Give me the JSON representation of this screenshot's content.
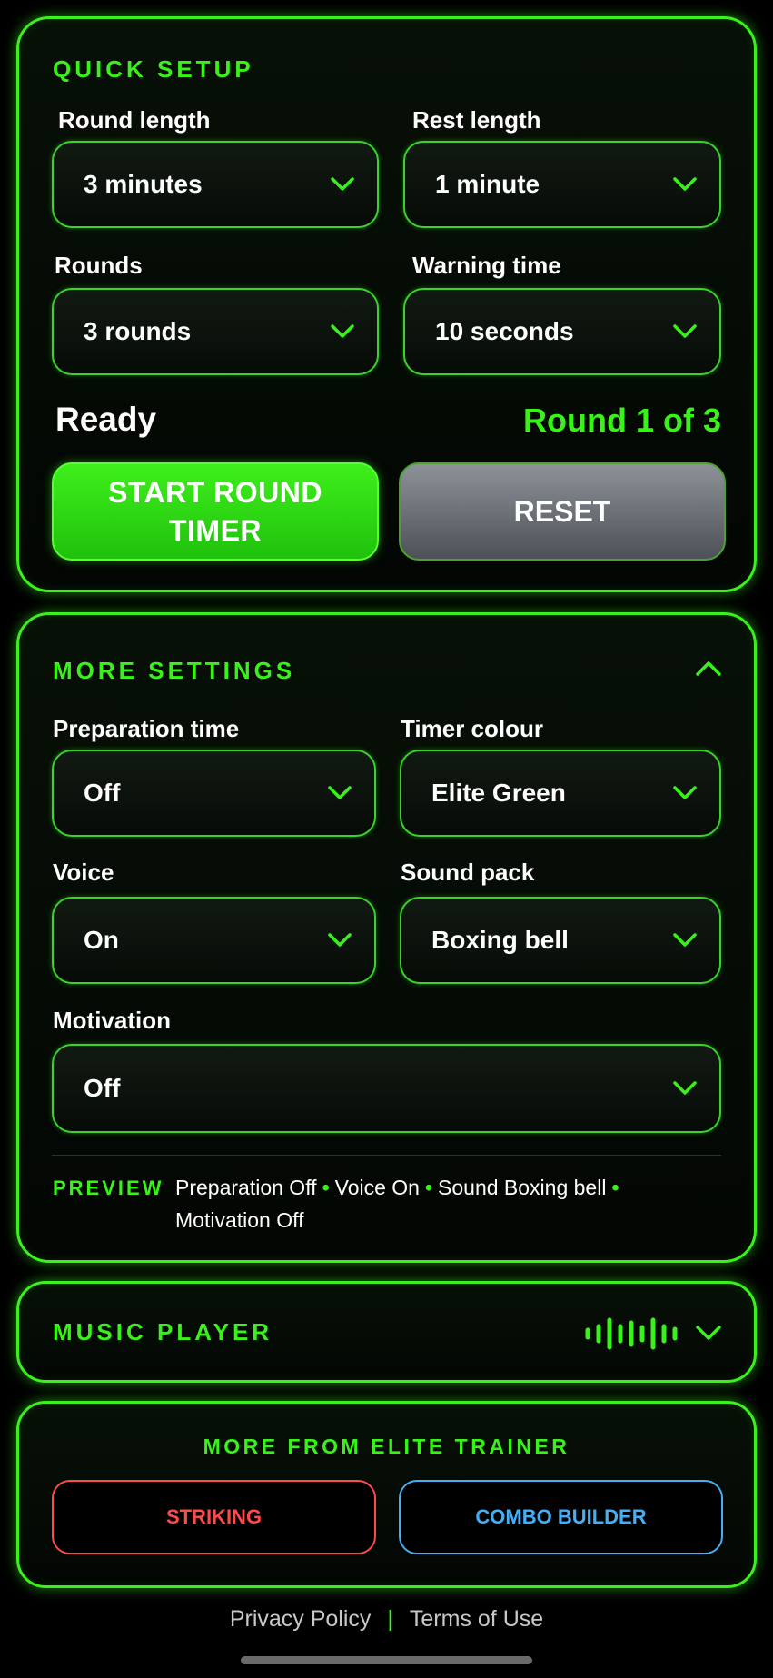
{
  "quick_setup": {
    "title": "QUICK SETUP",
    "round_length": {
      "label": "Round length",
      "value": "3 minutes"
    },
    "rest_length": {
      "label": "Rest length",
      "value": "1 minute"
    },
    "rounds": {
      "label": "Rounds",
      "value": "3 rounds"
    },
    "warning_time": {
      "label": "Warning time",
      "value": "10 seconds"
    },
    "status": "Ready",
    "round_indicator": "Round 1 of 3",
    "start_label_line1": "START ROUND",
    "start_label_line2": "TIMER",
    "reset_label": "RESET"
  },
  "more_settings": {
    "title": "MORE SETTINGS",
    "preparation_time": {
      "label": "Preparation time",
      "value": "Off"
    },
    "timer_colour": {
      "label": "Timer colour",
      "value": "Elite Green"
    },
    "voice": {
      "label": "Voice",
      "value": "On"
    },
    "sound_pack": {
      "label": "Sound pack",
      "value": "Boxing bell"
    },
    "motivation": {
      "label": "Motivation",
      "value": "Off"
    },
    "preview": {
      "label": "PREVIEW",
      "items": [
        "Preparation Off",
        "Voice On",
        "Sound Boxing bell",
        "Motivation Off"
      ]
    }
  },
  "music_player": {
    "title": "MUSIC PLAYER"
  },
  "more_from": {
    "title": "MORE FROM ELITE TRAINER",
    "striking_label": "STRIKING",
    "combo_label": "COMBO BUILDER"
  },
  "footer": {
    "privacy": "Privacy Policy",
    "separator": "|",
    "terms": "Terms of Use"
  },
  "colors": {
    "accent": "#39f21a",
    "striking": "#ff4a4a",
    "combo": "#45aef5"
  },
  "icons": [
    "chevron-down-icon",
    "chevron-up-icon",
    "equalizer-icon"
  ]
}
